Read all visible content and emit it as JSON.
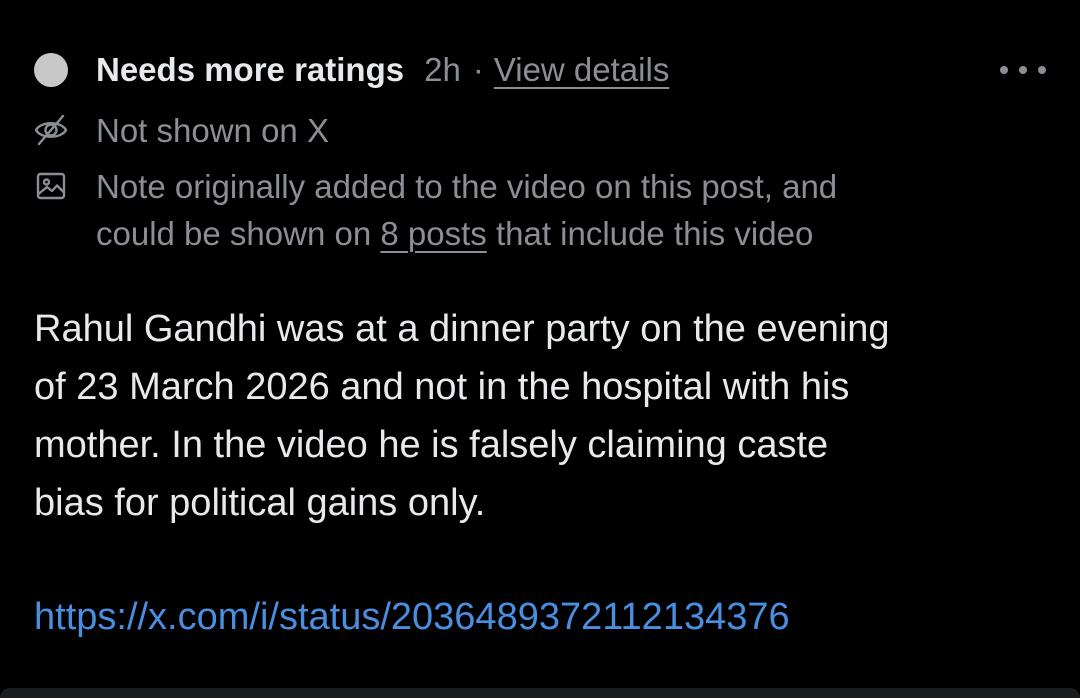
{
  "header": {
    "status_label": "Needs more ratings",
    "time": "2h",
    "separator": "·",
    "view_details_link": "View details"
  },
  "meta": {
    "visibility_text": "Not shown on X",
    "media_line_1": "Note originally added to the video on this post, and",
    "media_line_2_before": "could be shown on ",
    "media_line_2_link": "8 posts",
    "media_line_2_after": " that include this video"
  },
  "note": {
    "lines": [
      "Rahul Gandhi was at a dinner party on the evening",
      "of 23 March 2026 and not in the hospital with his",
      "mother. In the video he is falsely claiming caste",
      "bias for political gains only."
    ],
    "source_link": "https://x.com/i/status/2036489372112134376"
  },
  "icons": {
    "status": "status-dot-icon",
    "visibility": "eye-slash-icon",
    "media": "image-icon",
    "more": "more-options-icon"
  },
  "colors": {
    "background": "#000000",
    "primary_text": "#e7e9ea",
    "secondary_text": "#8b8f94",
    "link": "#4a8ee0",
    "status_dot": "#c8c8c8"
  }
}
